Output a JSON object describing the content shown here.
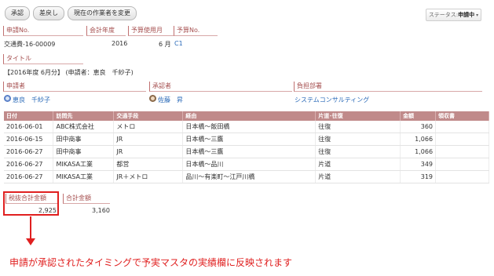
{
  "toolbar": {
    "approve_label": "承認",
    "return_label": "差戻し",
    "change_worker_label": "現在の作業者を変更"
  },
  "status": {
    "prefix": "ステータス:",
    "value": "申請中"
  },
  "header_fields": {
    "application_no_label": "申請No.",
    "application_no_value": "交通費-16-00009",
    "accounting_year_label": "会計年度",
    "accounting_year_value": "2016",
    "budget_month_label": "予算使用月",
    "budget_month_value": "6 月",
    "budget_no_label": "予算No.",
    "budget_no_value": "C1"
  },
  "title_field": {
    "label": "タイトル",
    "value": "【2016年度 6月分】 (申請者：恵良　千紗子)"
  },
  "people": {
    "applicant_label": "申請者",
    "applicant_value": "恵良　千紗子",
    "approver_label": "承認者",
    "approver_value": "佐藤　昇",
    "department_label": "負担部署",
    "department_value": "システムコンサルティング"
  },
  "table": {
    "headers": [
      "日付",
      "訪問先",
      "交通手段",
      "経由",
      "片道･往復",
      "金額",
      "領収書"
    ],
    "rows": [
      [
        "2016-06-01",
        "ABC株式会社",
        "メトロ",
        "日本橋～飯田橋",
        "往復",
        "360",
        ""
      ],
      [
        "2016-06-15",
        "田中商事",
        "JR",
        "日本橋～三鷹",
        "往復",
        "1,066",
        ""
      ],
      [
        "2016-06-27",
        "田中商事",
        "JR",
        "日本橋～三鷹",
        "往復",
        "1,066",
        ""
      ],
      [
        "2016-06-27",
        "MIKASA工業",
        "都営",
        "日本橋～品川",
        "片道",
        "349",
        ""
      ],
      [
        "2016-06-27",
        "MIKASA工業",
        "JR＋メトロ",
        "品川～有楽町～江戸川橋",
        "片道",
        "319",
        ""
      ]
    ]
  },
  "totals": {
    "pretax_label": "税抜合計金額",
    "pretax_value": "2,925",
    "total_label": "合計金額",
    "total_value": "3,160"
  },
  "annotation": {
    "note": "申請が承認されたタイミングで予実マスタの実績欄に反映されます"
  },
  "colors": {
    "label_accent": "#a65050",
    "table_header_bg": "#c08a8a",
    "link": "#2a6ab8",
    "annotation_red": "#e02020"
  }
}
